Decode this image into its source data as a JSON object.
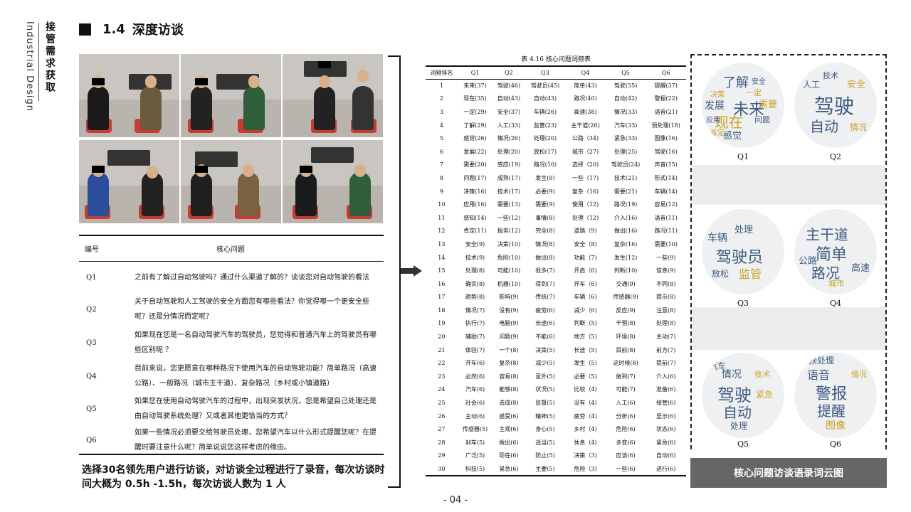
{
  "sidebar": {
    "english": "Industrial Design",
    "chinese": "接管需求获取"
  },
  "section": {
    "number": "1.4",
    "title": "深度访谈"
  },
  "questions": {
    "header_id": "编号",
    "header_q": "核心问题",
    "rows": [
      {
        "id": "Q1",
        "text": "之前有了解过自动驾驶吗？通过什么渠道了解的？谈谈您对自动驾驶的看法"
      },
      {
        "id": "Q2",
        "text": "关于自动驾驶和人工驾驶的安全方面您有哪些看法？你觉得哪一个更安全些呢？还是分情况而定呢？"
      },
      {
        "id": "Q3",
        "text": "如果现在您是一名自动驾驶汽车的驾驶员，您觉得和普通汽车上的驾驶员有哪些区别呢 ？"
      },
      {
        "id": "Q4",
        "text": "目前来说，您更愿意在哪种路况下使用汽车的自动驾驶功能？简单路况（高速公路）、一般路况（城市主干道）、复杂路况（乡村或小镇道路）"
      },
      {
        "id": "Q5",
        "text": "如果您在使用自动驾驶汽车的过程中，出现突发状况，您是希望自己处理还是由自动驾驶系统处理？又或者其他更恰当的方式？"
      },
      {
        "id": "Q6",
        "text": "如果一些情况必须要交给驾驶员处理，您希望汽车以什么形式提醒您呢？在提醒时要注意什么呢？简单说说您这样考虑的缘由。"
      }
    ]
  },
  "caption": "选择30名领先用户进行访谈，对访谈全过程进行了录音，每次访谈时间大概为 0.5h -1.5h，每次访谈人数为 1 人",
  "freq_table": {
    "title": "表 4.16  核心问题词频表",
    "headers": [
      "词频排名",
      "Q1",
      "Q2",
      "Q3",
      "Q4",
      "Q5",
      "Q6"
    ],
    "rows": [
      [
        "1",
        "未来(37)",
        "驾驶(46)",
        "驾驶员(45)",
        "简单(43)",
        "驾驶(55)",
        "提醒(37)"
      ],
      [
        "2",
        "现在(35)",
        "自动(43)",
        "自动(43)",
        "路况(40)",
        "自动(42)",
        "警报(22)"
      ],
      [
        "3",
        "一定(29)",
        "安全(37)",
        "车辆(26)",
        "高速(38)",
        "情况(33)",
        "语音(21)"
      ],
      [
        "4",
        "了解(29)",
        "人工(33)",
        "监管(23)",
        "主干道(26)",
        "汽车(33)",
        "预处理(18)"
      ],
      [
        "5",
        "感觉(26)",
        "情况(26)",
        "处理(20)",
        "公路（34)",
        "紧急(33)",
        "图像(16)"
      ],
      [
        "6",
        "发展(22)",
        "处理(20)",
        "放松(17)",
        "城市（27)",
        "处理(25)",
        "驾驶(16)"
      ],
      [
        "7",
        "需要(20)",
        "感应(19)",
        "路况(10)",
        "选择（20)",
        "驾驶员(24)",
        "声音(15)"
      ],
      [
        "8",
        "问题(17)",
        "成熟(17)",
        "发生(9)",
        "一些（17)",
        "技术(21)",
        "形式(14)"
      ],
      [
        "9",
        "决策(16)",
        "技术(17)",
        "必要(9)",
        "复杂（16)",
        "需要(21)",
        "车辆(14)"
      ],
      [
        "10",
        "应用(16)",
        "需要(13)",
        "需要(9)",
        "使用（12)",
        "路况(19)",
        "容易(12)"
      ],
      [
        "11",
        "感知(14)",
        "一些(12)",
        "事情(8)",
        "处理（12)",
        "介入(16)",
        "语音(11)"
      ],
      [
        "12",
        "肯定(11)",
        "报务(12)",
        "完全(8)",
        "道路（9)",
        "做出(16)",
        "路况(11)"
      ],
      [
        "13",
        "安全(9)",
        "决策(10)",
        "情况(8)",
        "安全（8)",
        "复杂(16)",
        "需要(10)"
      ],
      [
        "14",
        "技术(9)",
        "危险(10)",
        "做出(8)",
        "功能（7)",
        "发生(12)",
        "一些(9)"
      ],
      [
        "15",
        "处理(8)",
        "可能(10)",
        "很多(7)",
        "开启（6)",
        "判断(10)",
        "信息(9)"
      ],
      [
        "16",
        "确实(8)",
        "机器(10)",
        "得到(7)",
        "开车（6)",
        "交通(9)",
        "不同(8)"
      ],
      [
        "17",
        "趋势(8)",
        "影响(9)",
        "传统(7)",
        "车辆（6)",
        "传感器(9)",
        "提示(8)"
      ],
      [
        "18",
        "情况(7)",
        "没有(9)",
        "疲劳(6)",
        "减少（6)",
        "反应(9)",
        "注意(8)"
      ],
      [
        "19",
        "执行(7)",
        "电脑(9)",
        "长途(6)",
        "判断（5)",
        "干预(8)",
        "处理(8)"
      ],
      [
        "20",
        "辅助(7)",
        "问题(9)",
        "不能(6)",
        "地方（5)",
        "环境(8)",
        "主动(7)"
      ],
      [
        "21",
        "体验(7)",
        "一个(8)",
        "决策(5)",
        "长途（5)",
        "目前(8)",
        "前方(7)"
      ],
      [
        "22",
        "开车(6)",
        "复杂(8)",
        "减少(5)",
        "发生（5)",
        "这时候(8)",
        "提前(7)"
      ],
      [
        "23",
        "必然(6)",
        "容易(8)",
        "意外(5)",
        "必要（5)",
        "做到(7)",
        "介入(6)"
      ],
      [
        "24",
        "汽车(6)",
        "能够(8)",
        "状况(5)",
        "比较（4)",
        "可能(7)",
        "准备(6)"
      ],
      [
        "25",
        "社会(6)",
        "造成(8)",
        "监督(5)",
        "没有（4)",
        "人工(6)",
        "接管(6)"
      ],
      [
        "26",
        "主动(6)",
        "感受(6)",
        "精神(5)",
        "疲劳（4)",
        "分析(6)",
        "显示(6)"
      ],
      [
        "27",
        "传感器(5)",
        "主观(6)",
        "身心(5)",
        "乡村（4)",
        "危险(6)",
        "状态(6)"
      ],
      [
        "28",
        "刹车(5)",
        "做出(6)",
        "适当(5)",
        "休息（4)",
        "多变(6)",
        "紧急(6)"
      ],
      [
        "29",
        "广泛(5)",
        "现在(6)",
        "防止(5)",
        "决策（3)",
        "应该(6)",
        "自动(6)"
      ],
      [
        "30",
        "科技(5)",
        "紧急(6)",
        "主要(5)",
        "危险（3)",
        "一些(6)",
        "进行(6)"
      ]
    ]
  },
  "clouds": {
    "labels": [
      "Q1",
      "Q2",
      "Q3",
      "Q4",
      "Q5",
      "Q6"
    ],
    "q1_words": [
      "了解",
      "未来",
      "现在",
      "发展",
      "感觉",
      "决策",
      "需要",
      "问题",
      "一定",
      "应用",
      "肯定",
      "安全"
    ],
    "q2_words": [
      "驾驶",
      "自动",
      "安全",
      "人工",
      "情况",
      "技术"
    ],
    "q3_words": [
      "驾驶员",
      "监管",
      "车辆",
      "处理",
      "放松"
    ],
    "q4_words": [
      "主干道",
      "简单",
      "路况",
      "公路",
      "高速",
      "城市"
    ],
    "q5_words": [
      "驾驶",
      "自动",
      "情况",
      "汽车",
      "紧急",
      "处理",
      "技术"
    ],
    "q6_words": [
      "警报",
      "提醒",
      "语音",
      "预处理",
      "图像",
      "情况"
    ],
    "caption": "核心问题访谈语录词云图"
  },
  "footer": {
    "page": "- 04 -"
  },
  "colors": {
    "accent": "#111111",
    "cloud_blue": "#3d5a80",
    "cloud_gold": "#c9a227",
    "caption_bg": "#666666"
  }
}
